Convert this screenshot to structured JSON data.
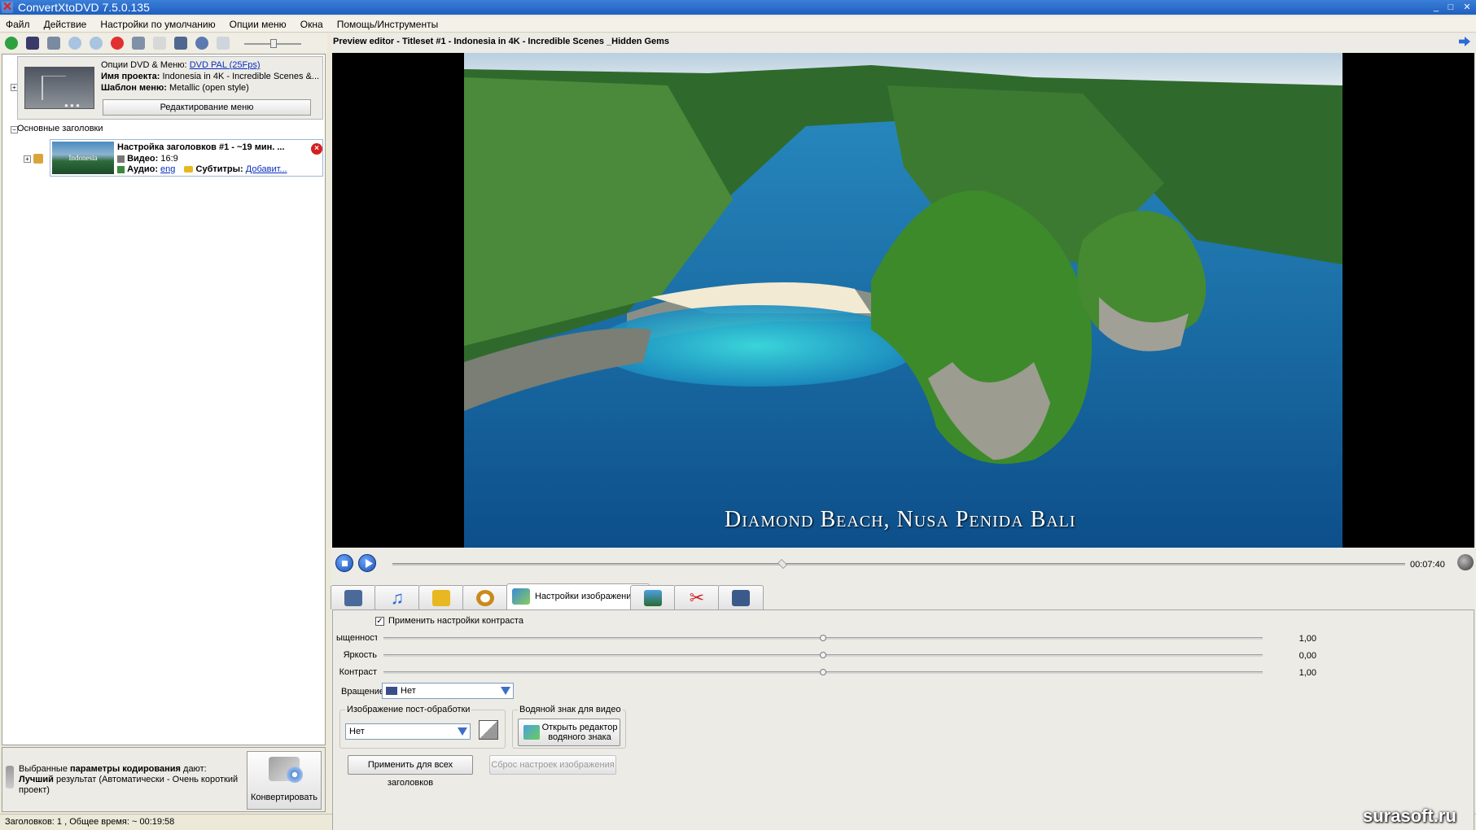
{
  "window": {
    "title": "ConvertXtoDVD 7.5.0.135",
    "controls": [
      "_",
      "□",
      "✕"
    ]
  },
  "menu": [
    "Файл",
    "Действие",
    "Настройки по умолчанию",
    "Опции меню",
    "Окна",
    "Помощь/Инструменты"
  ],
  "project": {
    "dvd_options_label": "Опции DVD & Меню:",
    "dvd_options_value": "DVD PAL (25Fps)",
    "name_label": "Имя проекта:",
    "name_value": "Indonesia in 4K - Incredible Scenes &...",
    "template_label": "Шаблон меню:",
    "template_value": "Metallic (open style)",
    "edit_menu_button": "Редактирование меню"
  },
  "tree": {
    "main_titles": "Основные заголовки",
    "title1": {
      "thumb_text": "Indonesia",
      "name": "Настройка заголовков #1 - ~19 мин. ...",
      "video_label": "Видео:",
      "video_value": "16:9",
      "audio_label": "Аудио:",
      "audio_value": "eng",
      "subtitles_label": "Субтитры:",
      "subtitles_value": "Добавит..."
    }
  },
  "encoding_info": {
    "line1_prefix": "Выбранные ",
    "line1_bold": "параметры кодирования",
    "line1_suffix": " дают:",
    "line2_bold": "Лучший",
    "line2_rest": " результат (Автоматически - Очень короткий",
    "line3": "проект)",
    "convert_button": "Конвертировать"
  },
  "status": "Заголовков: 1 , Общее время: ~ 00:19:58",
  "preview": {
    "title": "Preview editor - Titleset #1 - Indonesia in 4K - Incredible Scenes _Hidden Gems",
    "caption": "Diamond Beach, Nusa Penida Bali",
    "time": "00:07:40",
    "seek_position": 0.385
  },
  "tabs": {
    "active_label": "Настройки изображения"
  },
  "image_settings": {
    "apply_contrast": "Применить настройки контраста",
    "sliders": [
      {
        "label": "ыщенность",
        "value": "1,00",
        "position": 0.5
      },
      {
        "label": "Яркость",
        "value": "0,00",
        "position": 0.5
      },
      {
        "label": "Контраст",
        "value": "1,00",
        "position": 0.5
      }
    ],
    "rotation_label": "Вращение",
    "rotation_value": "Нет",
    "postproc_group": "Изображение пост-обработки",
    "postproc_value": "Нет",
    "watermark_group": "Водяной знак для видео",
    "watermark_button_line1": "Открыть редактор",
    "watermark_button_line2": "водяного знака",
    "apply_all": "Применить для всех заголовков",
    "reset": "Сброс настроек изображения"
  },
  "site_watermark": "surasoft.ru"
}
